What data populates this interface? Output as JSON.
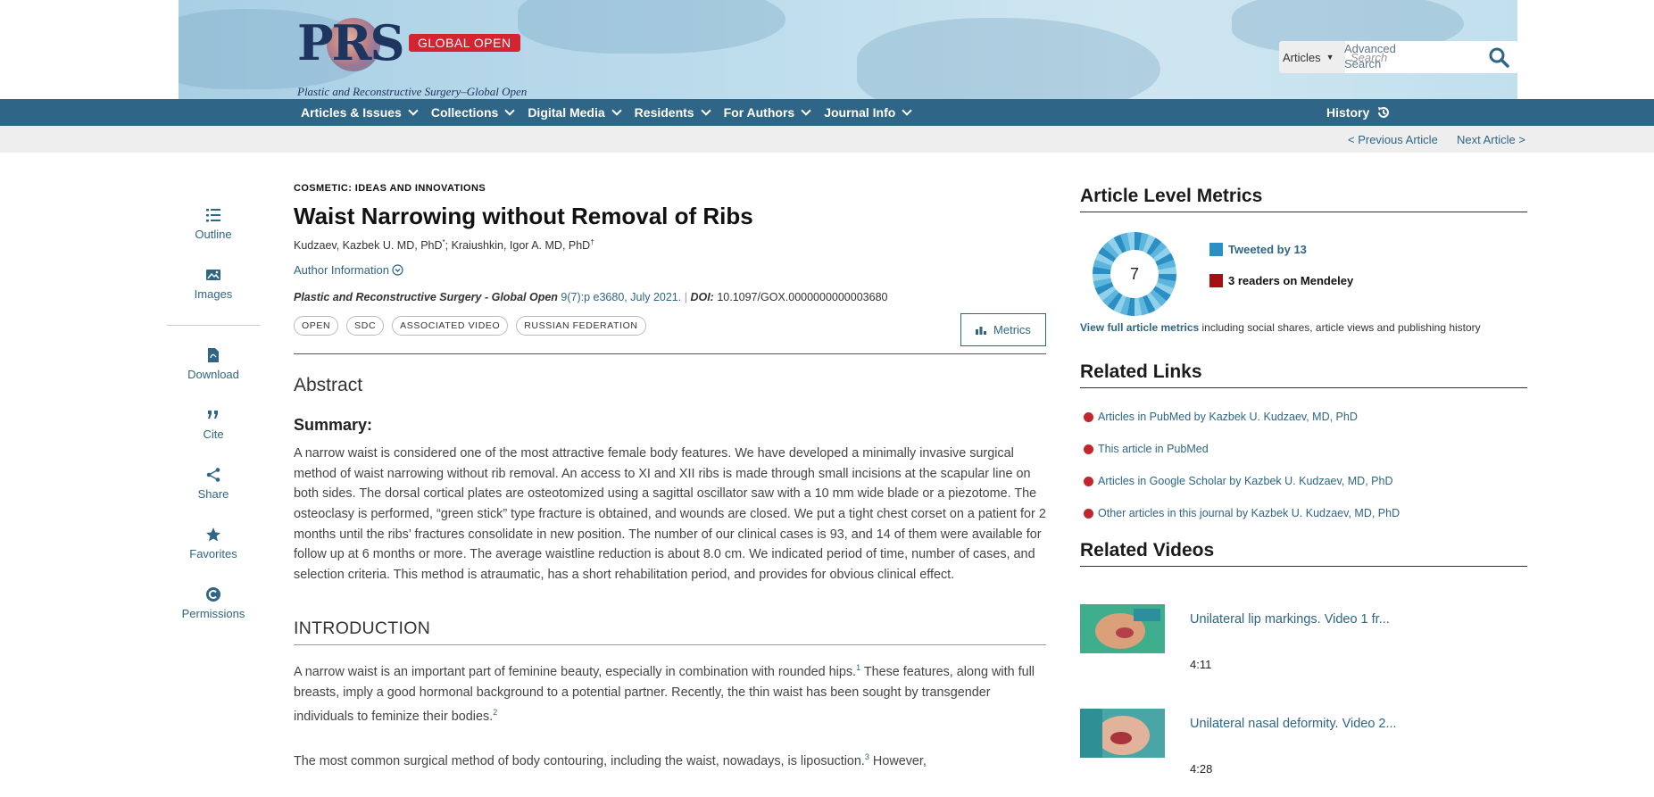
{
  "header": {
    "logo_text": "PRS",
    "logo_badge": "GLOBAL OPEN",
    "logo_tagline": "Plastic and Reconstructive Surgery–Global Open",
    "search_scope": "Articles",
    "search_placeholder": "Search",
    "advanced_search_line1": "Advanced",
    "advanced_search_line2": "Search"
  },
  "nav": {
    "items": [
      "Articles & Issues",
      "Collections",
      "Digital Media",
      "Residents",
      "For Authors",
      "Journal Info"
    ],
    "history": "History"
  },
  "subbar": {
    "previous": "< Previous Article",
    "next": "Next Article >"
  },
  "rail": {
    "outline": "Outline",
    "images": "Images",
    "download": "Download",
    "cite": "Cite",
    "share": "Share",
    "favorites": "Favorites",
    "permissions": "Permissions"
  },
  "article": {
    "section": "COSMETIC: IDEAS AND INNOVATIONS",
    "title": "Waist Narrowing without Removal of Ribs",
    "author1": "Kudzaev, Kazbek U. MD, PhD",
    "author1_mark": "*",
    "author_sep": "; ",
    "author2": "Kraiushkin, Igor A. MD, PhD",
    "author2_mark": "†",
    "author_info": "Author Information",
    "journal": "Plastic and Reconstructive Surgery - Global Open",
    "issue": "9(7):p e3680, July 2021.",
    "doi_label": "DOI:",
    "doi": "10.1097/GOX.0000000000003680",
    "tags": [
      "OPEN",
      "SDC",
      "ASSOCIATED VIDEO",
      "RUSSIAN FEDERATION"
    ],
    "metrics_button": "Metrics",
    "abstract_heading": "Abstract",
    "summary_heading": "Summary:",
    "summary_text": "A narrow waist is considered one of the most attractive female body features. We have developed a minimally invasive surgical method of waist narrowing without rib removal. An access to XI and XII ribs is made through small incisions at the scapular line on both sides. The dorsal cortical plates are osteotomized using a sagittal oscillator saw with a 10 mm wide blade or a piezotome. The osteoclasy is performed, “green stick” type fracture is obtained, and wounds are closed. We put a tight chest corset on a patient for 2 months until the ribs’ fractures consolidate in new position. The number of our clinical cases is 93, and 14 of them were available for follow up at 6 months or more. The average waistline reduction is about 8.0 cm. We indicated period of time, number of cases, and selection criteria. This method is atraumatic, has a short rehabilitation period, and provides for obvious clinical effect.",
    "intro_heading": "INTRODUCTION",
    "intro_p1a": "A narrow waist is an important part of feminine beauty, especially in combination with rounded hips.",
    "intro_ref1": "1",
    "intro_p1b": " These features, along with full breasts, imply a good hormonal background to a potential partner. Recently, the thin waist has been sought by transgender individuals to feminize their bodies.",
    "intro_ref2": "2",
    "intro_p2a": "The most common surgical method of body contouring, including the waist, nowadays, is liposuction.",
    "intro_ref3": "3",
    "intro_p2b": " However,"
  },
  "sidebar": {
    "metrics_heading": "Article Level Metrics",
    "altmetric_score": "7",
    "tweeted": "Tweeted by 13",
    "mendeley": "3 readers on Mendeley",
    "view_full": "View full article metrics",
    "view_full_rest": " including social shares, article views and publishing history",
    "related_links_heading": "Related Links",
    "related_links": [
      "Articles in PubMed by Kazbek U. Kudzaev, MD, PhD",
      "This article in PubMed",
      "Articles in Google Scholar by Kazbek U. Kudzaev, MD, PhD",
      "Other articles in this journal by Kazbek U. Kudzaev, MD, PhD"
    ],
    "related_videos_heading": "Related Videos",
    "videos": [
      {
        "title": "Unilateral lip markings. Video 1 fr...",
        "duration": "4:11"
      },
      {
        "title": "Unilateral nasal deformity. Video 2...",
        "duration": "4:28"
      }
    ]
  },
  "colors": {
    "nav": "#2f6586",
    "link": "#2f6586",
    "badge_red": "#d42331",
    "twitter": "#2b8fc3",
    "mendeley": "#a50f14",
    "bullet": "#c0272d"
  },
  "icons": [
    "search-icon",
    "chevron-down-icon",
    "history-icon",
    "outline-icon",
    "images-icon",
    "download-icon",
    "cite-icon",
    "share-icon",
    "star-icon",
    "permissions-icon",
    "chart-icon",
    "circle-chevron-icon"
  ]
}
